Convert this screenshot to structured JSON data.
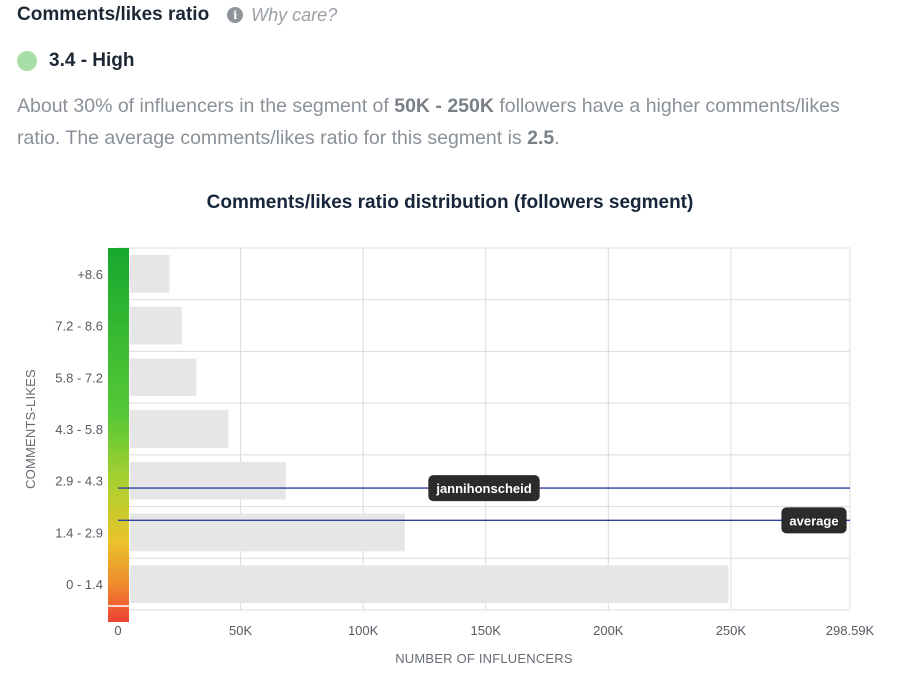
{
  "header": {
    "title": "Comments/likes ratio",
    "why_label": "Why care?",
    "info_icon": "info-icon"
  },
  "score": {
    "text": "3.4 - High",
    "color": "#a8dea8"
  },
  "description": {
    "part1": "About 30% of influencers in the segment of ",
    "segment": "50K - 250K",
    "part2": " followers have a higher comments/likes ratio. The average comments/likes ratio for this segment is ",
    "average": "2.5",
    "part3": "."
  },
  "chart_data": {
    "type": "bar",
    "orientation": "horizontal",
    "title": "Comments/likes ratio distribution (followers segment)",
    "xlabel": "NUMBER OF INFLUENCERS",
    "ylabel": "COMMENTS-LIKES",
    "categories": [
      "+8.6",
      "7.2 - 8.6",
      "5.8 - 7.2",
      "4.3 - 5.8",
      "2.9 - 4.3",
      "1.4 - 2.9",
      "0 - 1.4"
    ],
    "values": [
      21000,
      26000,
      32000,
      45000,
      68500,
      117000,
      249000
    ],
    "xlim": [
      0,
      298590
    ],
    "xticks": [
      {
        "value": 0,
        "label": "0"
      },
      {
        "value": 50000,
        "label": "50K"
      },
      {
        "value": 100000,
        "label": "100K"
      },
      {
        "value": 150000,
        "label": "150K"
      },
      {
        "value": 200000,
        "label": "200K"
      },
      {
        "value": 250000,
        "label": "250K"
      },
      {
        "value": 298590,
        "label": "298.59K"
      }
    ],
    "grid": true,
    "bar_color": "#e6e6e6",
    "markers": [
      {
        "label": "jannihonscheid",
        "value": 3.4,
        "color": "#2d3fa0"
      },
      {
        "label": "average",
        "value": 2.5,
        "color": "#2d3fa0"
      }
    ]
  }
}
